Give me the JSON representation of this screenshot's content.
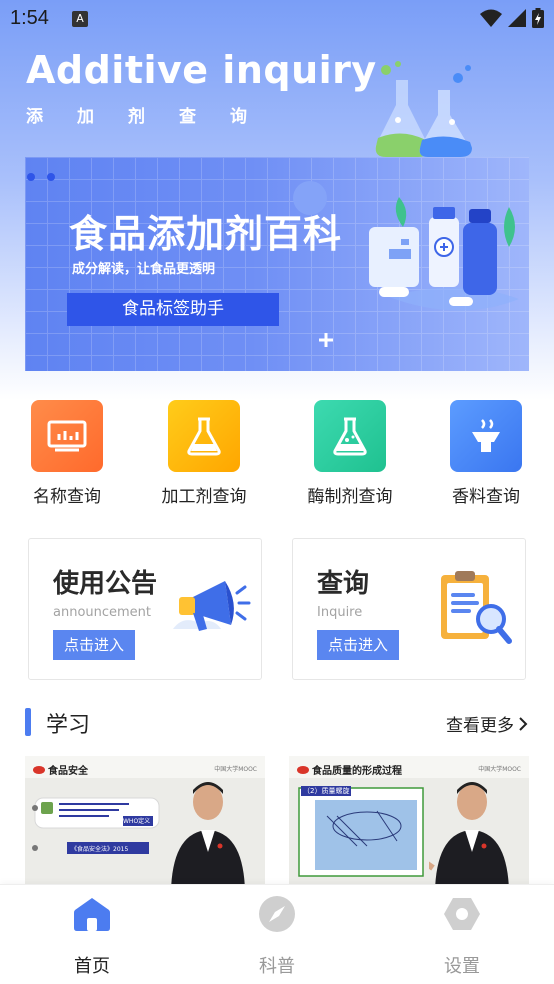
{
  "status": {
    "time": "1:54",
    "notif": "A"
  },
  "header": {
    "title": "Additive inquiry",
    "subtitle": "添加剂查询"
  },
  "banner": {
    "title": "食品添加剂百科",
    "subtitle": "成分解读，让食品更透明",
    "button": "食品标签助手"
  },
  "features": [
    {
      "label": "名称查询",
      "icon": "chart-icon",
      "color": "#ff7a3a"
    },
    {
      "label": "加工剂查询",
      "icon": "flask-icon",
      "color": "#ffb300"
    },
    {
      "label": "酶制剂查询",
      "icon": "beaker-icon",
      "color": "#2fd0a0"
    },
    {
      "label": "香料查询",
      "icon": "incense-icon",
      "color": "#4a8cf7"
    }
  ],
  "cards": [
    {
      "title": "使用公告",
      "en": "announcement",
      "button": "点击进入"
    },
    {
      "title": "查询",
      "en": "Inquire",
      "button": "点击进入"
    }
  ],
  "section": {
    "title": "学习",
    "more": "查看更多"
  },
  "videos": [
    {
      "tag": "食品安全",
      "box_text": "WHO定义",
      "law": "《食品安全法》2015",
      "logo": "中国大学MOOC"
    },
    {
      "tag": "食品质量的形成过程",
      "box_text": "（2）质量螺旋",
      "logo": "中国大学MOOC"
    }
  ],
  "tabs": [
    {
      "label": "首页",
      "icon": "home-icon",
      "active": true
    },
    {
      "label": "科普",
      "icon": "compass-icon",
      "active": false
    },
    {
      "label": "设置",
      "icon": "hexagon-settings-icon",
      "active": false
    }
  ],
  "colors": {
    "primary": "#4c7cf0",
    "banner_button": "#2f55e8",
    "card_button": "#5a86f0"
  }
}
